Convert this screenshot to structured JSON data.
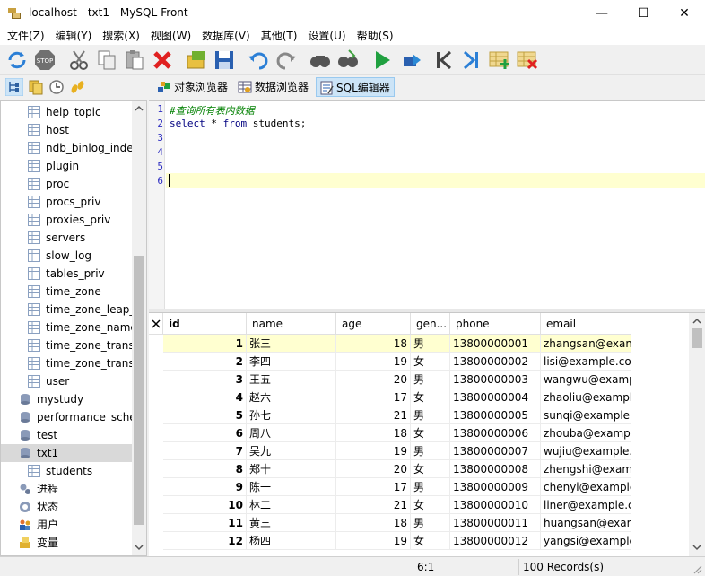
{
  "window": {
    "title": "localhost - txt1 - MySQL-Front",
    "min": "—",
    "max": "☐",
    "close": "✕"
  },
  "menu": [
    "文件(Z)",
    "编辑(Y)",
    "搜索(X)",
    "视图(W)",
    "数据库(V)",
    "其他(T)",
    "设置(U)",
    "帮助(S)"
  ],
  "views": {
    "object_browser": "对象浏览器",
    "data_browser": "数据浏览器",
    "sql_editor": "SQL编辑器"
  },
  "tree": [
    {
      "label": "help_topic",
      "type": "table"
    },
    {
      "label": "host",
      "type": "table"
    },
    {
      "label": "ndb_binlog_inde",
      "type": "table"
    },
    {
      "label": "plugin",
      "type": "table"
    },
    {
      "label": "proc",
      "type": "table"
    },
    {
      "label": "procs_priv",
      "type": "table"
    },
    {
      "label": "proxies_priv",
      "type": "table"
    },
    {
      "label": "servers",
      "type": "table"
    },
    {
      "label": "slow_log",
      "type": "table"
    },
    {
      "label": "tables_priv",
      "type": "table"
    },
    {
      "label": "time_zone",
      "type": "table"
    },
    {
      "label": "time_zone_leap_s",
      "type": "table"
    },
    {
      "label": "time_zone_name",
      "type": "table"
    },
    {
      "label": "time_zone_transi",
      "type": "table"
    },
    {
      "label": "time_zone_transi",
      "type": "table"
    },
    {
      "label": "user",
      "type": "table"
    },
    {
      "label": "mystudy",
      "type": "db"
    },
    {
      "label": "performance_sche",
      "type": "db"
    },
    {
      "label": "test",
      "type": "db"
    },
    {
      "label": "txt1",
      "type": "db",
      "selected": true
    },
    {
      "label": "students",
      "type": "table"
    },
    {
      "label": "进程",
      "type": "process"
    },
    {
      "label": "状态",
      "type": "status"
    },
    {
      "label": "用户",
      "type": "users"
    },
    {
      "label": "变量",
      "type": "variables"
    }
  ],
  "editor": {
    "line_numbers": [
      "1",
      "2",
      "3",
      "4",
      "5",
      "6"
    ],
    "comment": "#查询所有表内数据",
    "kw_select": "select",
    "star": " * ",
    "kw_from": "from",
    "rest": " students;"
  },
  "grid": {
    "columns": [
      "id",
      "name",
      "age",
      "gen...",
      "phone",
      "email"
    ],
    "rows": [
      [
        "1",
        "张三",
        "18",
        "男",
        "13800000001",
        "zhangsan@examp"
      ],
      [
        "2",
        "李四",
        "19",
        "女",
        "13800000002",
        "lisi@example.cor"
      ],
      [
        "3",
        "王五",
        "20",
        "男",
        "13800000003",
        "wangwu@exampl"
      ],
      [
        "4",
        "赵六",
        "17",
        "女",
        "13800000004",
        "zhaoliu@exampl"
      ],
      [
        "5",
        "孙七",
        "21",
        "男",
        "13800000005",
        "sunqi@example.c"
      ],
      [
        "6",
        "周八",
        "18",
        "女",
        "13800000006",
        "zhouba@exampl"
      ],
      [
        "7",
        "吴九",
        "19",
        "男",
        "13800000007",
        "wujiu@example.c"
      ],
      [
        "8",
        "郑十",
        "20",
        "女",
        "13800000008",
        "zhengshi@examp"
      ],
      [
        "9",
        "陈一",
        "17",
        "男",
        "13800000009",
        "chenyi@example"
      ],
      [
        "10",
        "林二",
        "21",
        "女",
        "13800000010",
        "liner@example.c"
      ],
      [
        "11",
        "黄三",
        "18",
        "男",
        "13800000011",
        "huangsan@exam"
      ],
      [
        "12",
        "杨四",
        "19",
        "女",
        "13800000012",
        "yangsi@example"
      ]
    ]
  },
  "status": {
    "position": "6:1",
    "records": "100 Records(s)"
  }
}
